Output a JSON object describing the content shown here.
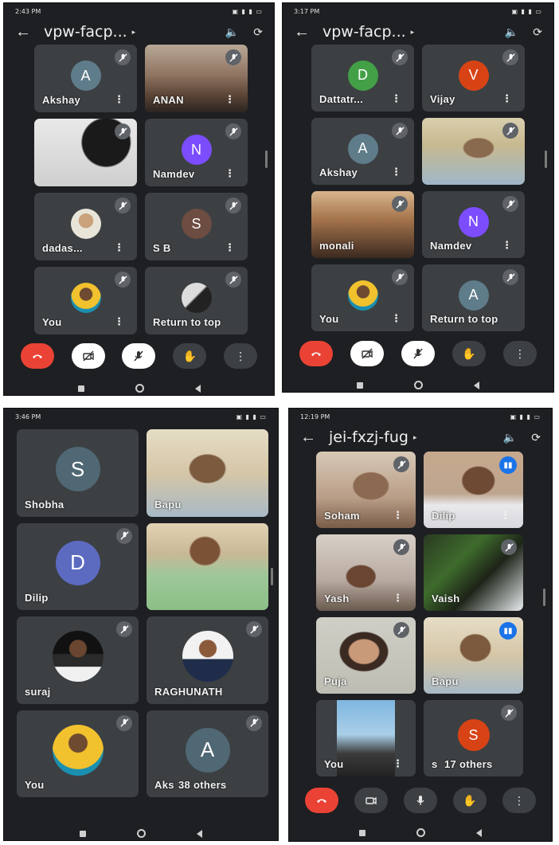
{
  "screens": [
    {
      "status_time": "2:43 PM",
      "status_right": "▣ ▮ ▮ ▭",
      "meeting_code": "vpw-facp...",
      "tiles": [
        {
          "name": "Akshay",
          "letter": "A",
          "color": "#5f7c8a"
        },
        {
          "name": "ANAN"
        },
        {
          "name": ""
        },
        {
          "name": "Namdev",
          "letter": "N",
          "color": "#7c4dff"
        },
        {
          "name": "dadas..."
        },
        {
          "name": "S B",
          "letter": "S",
          "color": "#6d4c41"
        },
        {
          "name": "You"
        },
        {
          "name": "Return to top"
        }
      ]
    },
    {
      "status_time": "3:17 PM",
      "status_right": "▣ ▮ ▮ ▭",
      "meeting_code": "vpw-facp...",
      "tiles": [
        {
          "name": "Dattatr...",
          "letter": "D",
          "color": "#43a047"
        },
        {
          "name": "Vijay",
          "letter": "V",
          "color": "#d84315"
        },
        {
          "name": "Akshay",
          "letter": "A",
          "color": "#5f7c8a"
        },
        {
          "name": ""
        },
        {
          "name": "monali"
        },
        {
          "name": "Namdev",
          "letter": "N",
          "color": "#7c4dff"
        },
        {
          "name": "You"
        },
        {
          "name": "Return to top",
          "letter": "A",
          "color": "#5f7c8a"
        }
      ]
    },
    {
      "status_time": "3:46 PM",
      "status_right": "▣ ▮ ▮ ▭",
      "tiles": [
        {
          "name": "Shobha",
          "letter": "S",
          "color": "#4f6874"
        },
        {
          "name": "Bapu"
        },
        {
          "name": "Dilip",
          "letter": "D",
          "color": "#5c6bc0"
        },
        {
          "name": ""
        },
        {
          "name": "suraj"
        },
        {
          "name": "RAGHUNATH"
        },
        {
          "name": "You"
        },
        {
          "name": "Aks",
          "letter": "A",
          "color": "#4f6874",
          "others": "38 others"
        }
      ]
    },
    {
      "status_time": "12:19 PM",
      "status_right": "▣ ▮ ▮ ▭",
      "meeting_code": "jei-fxzj-fug",
      "tiles": [
        {
          "name": "Soham"
        },
        {
          "name": "Dilip"
        },
        {
          "name": "Yash"
        },
        {
          "name": "Vaish"
        },
        {
          "name": "Puja"
        },
        {
          "name": "Bapu"
        },
        {
          "name": "You"
        },
        {
          "name": "s",
          "letter": "S",
          "color": "#d84315",
          "others": "17 others"
        }
      ]
    }
  ],
  "icons": {
    "back": "arrow-left-icon",
    "speaker": "speaker-icon",
    "switch_camera": "switch-camera-icon",
    "end_call": "end-call-icon",
    "camera_off": "camera-off-icon",
    "mic_off": "mic-off-icon",
    "raise_hand": "raise-hand-icon",
    "more": "more-vertical-icon",
    "muted": "mic-muted-icon",
    "speaking": "speaking-icon"
  },
  "colors": {
    "background": "#1e1f22",
    "tile": "#3c4043",
    "end_call": "#ea4335",
    "active_speaker": "#8ab4f8"
  }
}
